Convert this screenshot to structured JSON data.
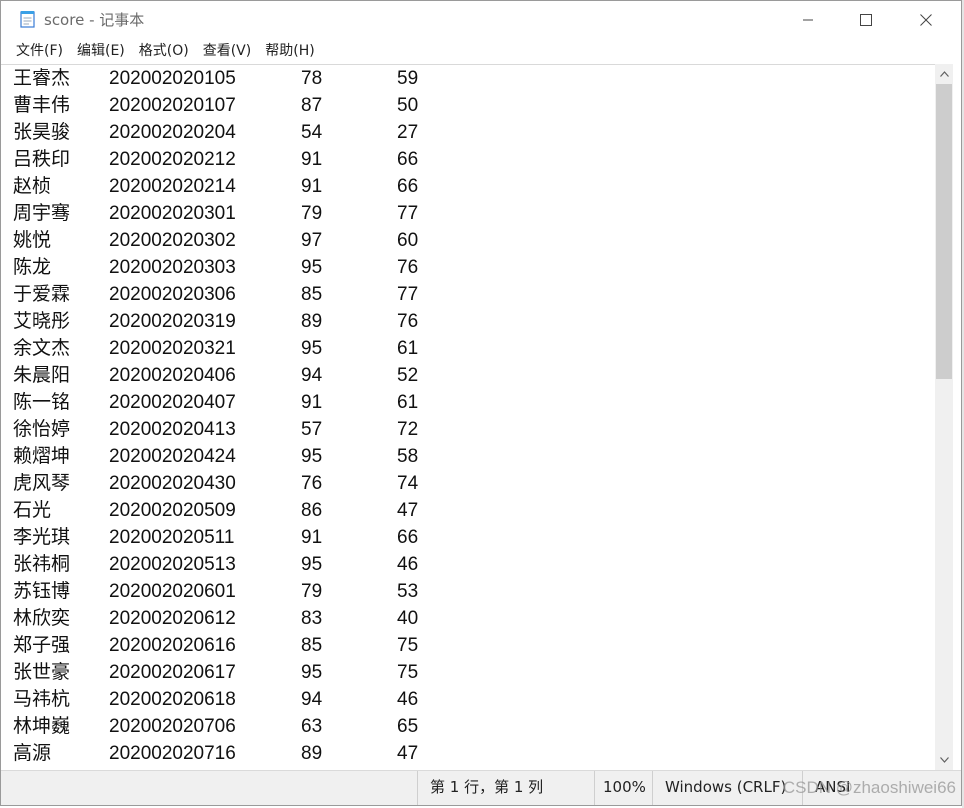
{
  "window": {
    "title": "score - 记事本",
    "controls": {
      "minimize": "—",
      "maximize": "☐",
      "close": "✕"
    }
  },
  "menu": [
    "文件(F)",
    "编辑(E)",
    "格式(O)",
    "查看(V)",
    "帮助(H)"
  ],
  "rows": [
    {
      "name": "王睿杰",
      "id": "202002020105",
      "a": "78",
      "b": "59"
    },
    {
      "name": "曹丰伟",
      "id": "202002020107",
      "a": "87",
      "b": "50"
    },
    {
      "name": "张昊骏",
      "id": "202002020204",
      "a": "54",
      "b": "27"
    },
    {
      "name": "吕秩印",
      "id": "202002020212",
      "a": "91",
      "b": "66"
    },
    {
      "name": "赵桢",
      "id": "202002020214",
      "a": "91",
      "b": "66"
    },
    {
      "name": "周宇骞",
      "id": "202002020301",
      "a": "79",
      "b": "77"
    },
    {
      "name": "姚悦",
      "id": "202002020302",
      "a": "97",
      "b": "60"
    },
    {
      "name": "陈龙",
      "id": "202002020303",
      "a": "95",
      "b": "76"
    },
    {
      "name": "于爱霖",
      "id": "202002020306",
      "a": "85",
      "b": "77"
    },
    {
      "name": "艾晓彤",
      "id": "202002020319",
      "a": "89",
      "b": "76"
    },
    {
      "name": "余文杰",
      "id": "202002020321",
      "a": "95",
      "b": "61"
    },
    {
      "name": "朱晨阳",
      "id": "202002020406",
      "a": "94",
      "b": "52"
    },
    {
      "name": "陈一铭",
      "id": "202002020407",
      "a": "91",
      "b": "61"
    },
    {
      "name": "徐怡婷",
      "id": "202002020413",
      "a": "57",
      "b": "72"
    },
    {
      "name": "赖熠坤",
      "id": "202002020424",
      "a": "95",
      "b": "58"
    },
    {
      "name": "虎风琴",
      "id": "202002020430",
      "a": "76",
      "b": "74"
    },
    {
      "name": "石光",
      "id": "202002020509",
      "a": "86",
      "b": "47"
    },
    {
      "name": "李光琪",
      "id": "202002020511",
      "a": "91",
      "b": "66"
    },
    {
      "name": "张祎桐",
      "id": "202002020513",
      "a": "95",
      "b": "46"
    },
    {
      "name": "苏钰博",
      "id": "202002020601",
      "a": "79",
      "b": "53"
    },
    {
      "name": "林欣奕",
      "id": "202002020612",
      "a": "83",
      "b": "40"
    },
    {
      "name": "郑子强",
      "id": "202002020616",
      "a": "85",
      "b": "75"
    },
    {
      "name": "张世豪",
      "id": "202002020617",
      "a": "95",
      "b": "75"
    },
    {
      "name": "马祎杭",
      "id": "202002020618",
      "a": "94",
      "b": "46"
    },
    {
      "name": "林坤巍",
      "id": "202002020706",
      "a": "63",
      "b": "65"
    },
    {
      "name": "高源",
      "id": "202002020716",
      "a": "89",
      "b": "47"
    }
  ],
  "status": {
    "position": "第 1 行，第 1 列",
    "zoom": "100%",
    "line_ending": "Windows (CRLF)",
    "encoding": "ANSI"
  },
  "watermark": "CSDN @zhaoshiwei66",
  "scroll_position_fraction": 0
}
